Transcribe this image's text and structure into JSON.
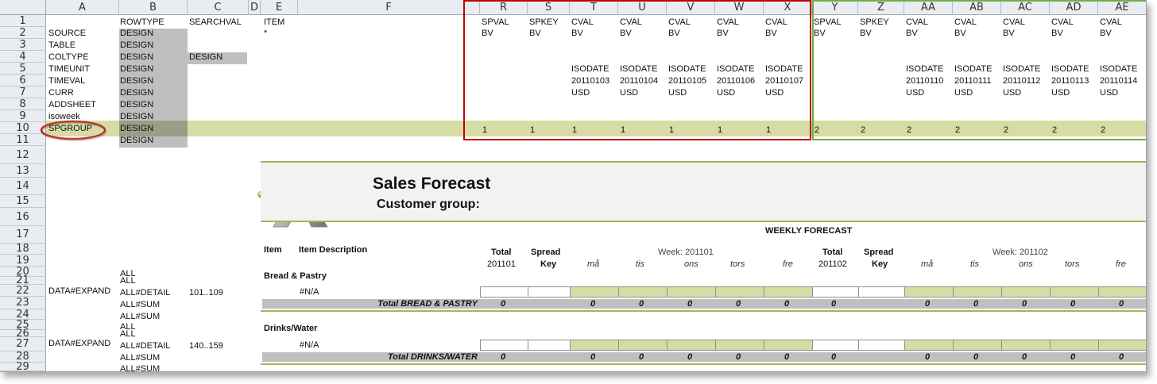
{
  "columns": [
    "A",
    "B",
    "C",
    "D",
    "E",
    "F",
    "R",
    "S",
    "T",
    "U",
    "V",
    "W",
    "X",
    "Y",
    "Z",
    "AA",
    "AB",
    "AC",
    "AD",
    "AE"
  ],
  "rows": [
    "1",
    "2",
    "3",
    "4",
    "5",
    "6",
    "7",
    "8",
    "9",
    "10",
    "11",
    "12",
    "13",
    "14",
    "15",
    "16",
    "17",
    "18",
    "19",
    "20",
    "21",
    "22",
    "23",
    "24",
    "25",
    "26",
    "27",
    "28",
    "29"
  ],
  "colA": {
    "r2": "SOURCE",
    "r3": "TABLE",
    "r4": "COLTYPE",
    "r5": "TIMEUNIT",
    "r6": "TIMEVAL",
    "r7": "CURR",
    "r8": "ADDSHEET",
    "r9": "isoweek",
    "r10": "SPGROUP",
    "r22": "DATA#EXPAND",
    "r27": "DATA#EXPAND"
  },
  "colB": {
    "r1": "ROWTYPE",
    "design": "DESIGN",
    "r20a": "ALL",
    "r20b": "ALL",
    "r22": "ALL#DETAIL",
    "r23": "ALL#SUM",
    "r24": "ALL#SUM",
    "r25a": "ALL",
    "r25b": "ALL",
    "r27": "ALL#DETAIL",
    "r28": "ALL#SUM",
    "r29": "ALL#SUM"
  },
  "colC": {
    "r1": "SEARCHVAL",
    "r4": "DESIGN",
    "r22": "101..109",
    "r27": "140..159"
  },
  "colE": {
    "r1": "ITEM",
    "r2": "*"
  },
  "spcols": [
    {
      "r1": "SPVAL",
      "r2": "BV",
      "r5": "",
      "r6": "",
      "r7": "",
      "r10": "1"
    },
    {
      "r1": "SPKEY",
      "r2": "BV",
      "r5": "",
      "r6": "",
      "r7": "",
      "r10": "1"
    },
    {
      "r1": "CVAL",
      "r2": "BV",
      "r5": "ISODATE",
      "r6": "20110103",
      "r7": "USD",
      "r10": "1"
    },
    {
      "r1": "CVAL",
      "r2": "BV",
      "r5": "ISODATE",
      "r6": "20110104",
      "r7": "USD",
      "r10": "1"
    },
    {
      "r1": "CVAL",
      "r2": "BV",
      "r5": "ISODATE",
      "r6": "20110105",
      "r7": "USD",
      "r10": "1"
    },
    {
      "r1": "CVAL",
      "r2": "BV",
      "r5": "ISODATE",
      "r6": "20110106",
      "r7": "USD",
      "r10": "1"
    },
    {
      "r1": "CVAL",
      "r2": "BV",
      "r5": "ISODATE",
      "r6": "20110107",
      "r7": "USD",
      "r10": "1"
    },
    {
      "r1": "SPVAL",
      "r2": "BV",
      "r5": "",
      "r6": "",
      "r7": "",
      "r10": "2"
    },
    {
      "r1": "SPKEY",
      "r2": "BV",
      "r5": "",
      "r6": "",
      "r7": "",
      "r10": "2"
    },
    {
      "r1": "CVAL",
      "r2": "BV",
      "r5": "ISODATE",
      "r6": "20110110",
      "r7": "USD",
      "r10": "2"
    },
    {
      "r1": "CVAL",
      "r2": "BV",
      "r5": "ISODATE",
      "r6": "20110111",
      "r7": "USD",
      "r10": "2"
    },
    {
      "r1": "CVAL",
      "r2": "BV",
      "r5": "ISODATE",
      "r6": "20110112",
      "r7": "USD",
      "r10": "2"
    },
    {
      "r1": "CVAL",
      "r2": "BV",
      "r5": "ISODATE",
      "r6": "20110113",
      "r7": "USD",
      "r10": "2"
    },
    {
      "r1": "CVAL",
      "r2": "BV",
      "r5": "ISODATE",
      "r6": "20110114",
      "r7": "USD",
      "r10": "2"
    }
  ],
  "report": {
    "title": "Sales Forecast",
    "subtitle": "Customer group:",
    "weekly": "WEEKLY FORECAST",
    "item": "Item",
    "itemdesc": "Item Description",
    "total": "Total",
    "spread": "Spread",
    "key": "Key",
    "week1": "Week: 201101",
    "week2": "Week: 201102",
    "period1": "201101",
    "period2": "201102",
    "days": [
      "må",
      "tis",
      "ons",
      "tors",
      "fre"
    ],
    "group1": "Bread & Pastry",
    "group2": "Drinks/Water",
    "na": "#N/A",
    "total1": "Total BREAD & PASTRY",
    "total2": "Total DRINKS/WATER",
    "zero": "0"
  },
  "colors": {
    "red_box": "#c00000",
    "green_box": "#70ad47",
    "band": "#d6dca4",
    "grey": "#bfbfbf",
    "accent": "#9bbb59"
  }
}
